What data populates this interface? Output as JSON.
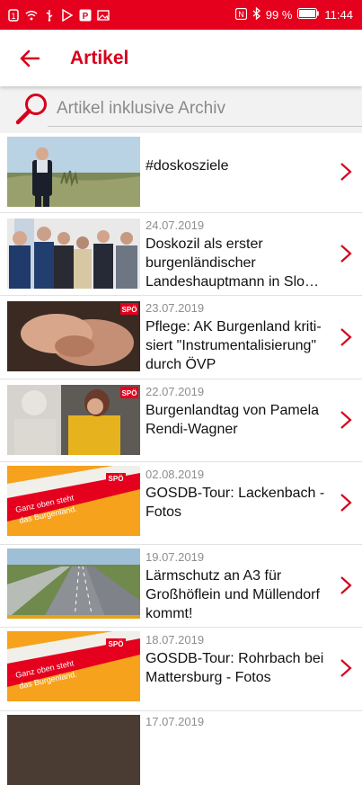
{
  "status_bar": {
    "battery": "99 %",
    "time": "11:44"
  },
  "app_bar": {
    "title": "Artikel"
  },
  "search": {
    "placeholder": "Artikel inklusive Archiv"
  },
  "articles": [
    {
      "date": "",
      "title": "#doskosziele"
    },
    {
      "date": "24.07.2019",
      "title": "Doskozil als erster burgenländischer Landeshauptmann in Slo…"
    },
    {
      "date": "23.07.2019",
      "title": "Pflege: AK Burgenland kriti-siert \"Instrumentalisierung\" durch ÖVP"
    },
    {
      "date": "22.07.2019",
      "title": "Burgenlandtag von Pamela Rendi-Wagner"
    },
    {
      "date": "02.08.2019",
      "title": "GOSDB-Tour: Lackenbach - Fotos"
    },
    {
      "date": "19.07.2019",
      "title": "Lärmschutz an A3 für Großhöflein und Müllendorf kommt!"
    },
    {
      "date": "18.07.2019",
      "title": "GOSDB-Tour: Rohrbach bei Mattersburg - Fotos"
    },
    {
      "date": "17.07.2019",
      "title": ""
    }
  ],
  "thumb_text": {
    "spo_logo": "SPÖ",
    "flyer_line1": "Ganz oben steht",
    "flyer_line2": "das Burgenland."
  },
  "colors": {
    "accent": "#e5001d",
    "title_red": "#d6001c"
  }
}
